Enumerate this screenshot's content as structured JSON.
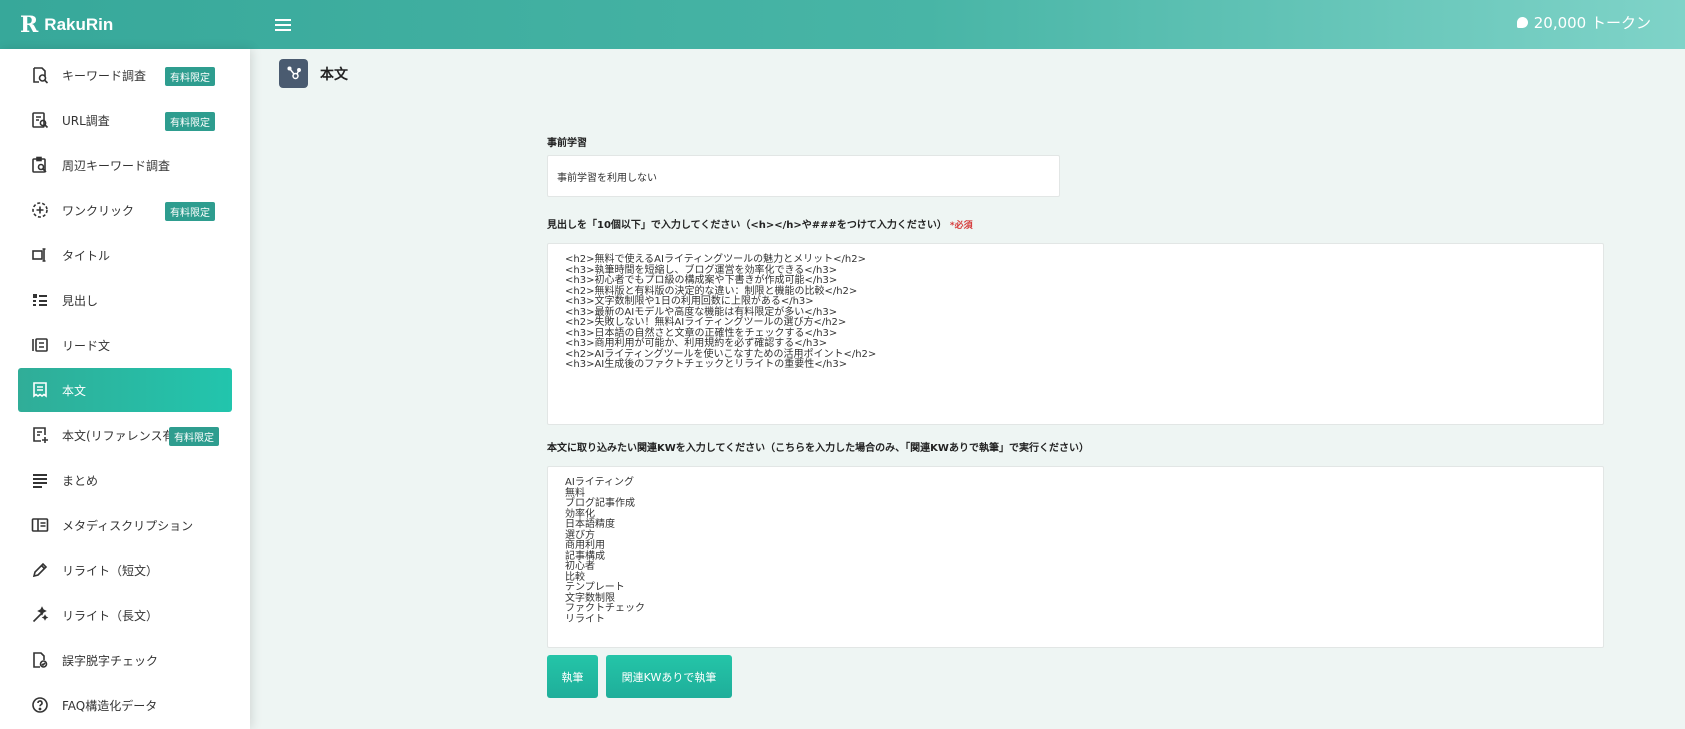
{
  "app": {
    "name": "RakuRin",
    "logo_mark": "R"
  },
  "header": {
    "menu_icon": "hamburger-icon",
    "tokens": "20,000 トークン"
  },
  "sidebar": {
    "items": [
      {
        "label": "キーワード調査",
        "icon": "keyword-search-icon",
        "badge": "有料限定"
      },
      {
        "label": "URL調査",
        "icon": "url-search-icon",
        "badge": "有料限定"
      },
      {
        "label": "周辺キーワード調査",
        "icon": "related-keyword-icon"
      },
      {
        "label": "ワンクリック",
        "icon": "one-click-icon",
        "badge": "有料限定"
      },
      {
        "label": "タイトル",
        "icon": "title-icon"
      },
      {
        "label": "見出し",
        "icon": "heading-list-icon"
      },
      {
        "label": "リード文",
        "icon": "lead-text-icon"
      },
      {
        "label": "本文",
        "icon": "body-text-icon",
        "active": true
      },
      {
        "label": "本文(リファレンス有)",
        "icon": "body-reference-icon",
        "badge": "有料限定"
      },
      {
        "label": "まとめ",
        "icon": "summary-icon"
      },
      {
        "label": "メタディスクリプション",
        "icon": "meta-description-icon"
      },
      {
        "label": "リライト（短文）",
        "icon": "pencil-icon"
      },
      {
        "label": "リライト（長文）",
        "icon": "magic-pencil-icon"
      },
      {
        "label": "誤字脱字チェック",
        "icon": "proofread-icon"
      },
      {
        "label": "FAQ構造化データ",
        "icon": "faq-icon"
      }
    ]
  },
  "main": {
    "page_title": "本文",
    "pre_learning": {
      "label": "事前学習",
      "value": "事前学習を利用しない"
    },
    "headings": {
      "label": "見出しを「10個以下」で入力してください（<h></h>や###をつけて入力ください）",
      "required": "*必須",
      "value": "<h2>無料で使えるAIライティングツールの魅力とメリット</h2>\n<h3>執筆時間を短縮し、ブログ運営を効率化できる</h3>\n<h3>初心者でもプロ級の構成案や下書きが作成可能</h3>\n<h2>無料版と有料版の決定的な違い：制限と機能の比較</h2>\n<h3>文字数制限や1日の利用回数に上限がある</h3>\n<h3>最新のAIモデルや高度な機能は有料限定が多い</h3>\n<h2>失敗しない！無料AIライティングツールの選び方</h2>\n<h3>日本語の自然さと文章の正確性をチェックする</h3>\n<h3>商用利用が可能か、利用規約を必ず確認する</h3>\n<h2>AIライティングツールを使いこなすための活用ポイント</h2>\n<h3>AI生成後のファクトチェックとリライトの重要性</h3>"
    },
    "keywords": {
      "label": "本文に取り込みたい関連KWを入力してください（こちらを入力した場合のみ、「関連KWありで執筆」で実行ください）",
      "value": "AIライティング\n無料\nブログ記事作成\n効率化\n日本語精度\n選び方\n商用利用\n記事構成\n初心者\n比較\nテンプレート\n文字数制限\nファクトチェック\nリライト"
    },
    "buttons": {
      "write": "執筆",
      "write_with_kw": "関連KWありで執筆"
    }
  },
  "colors": {
    "accent": "#22c5ad",
    "badge": "#2e9d8f",
    "required": "#d63c3c"
  }
}
